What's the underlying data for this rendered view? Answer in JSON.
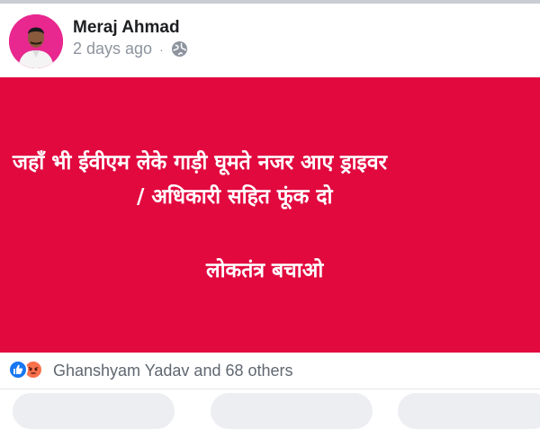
{
  "post": {
    "author": "Meraj Ahmad",
    "time": "2 days ago",
    "separator": "·",
    "privacy_icon": "globe-icon",
    "body_color": "#e2093f",
    "body_lines": [
      "जहाँ भी ईवीएम लेके गाड़ी घूमते नजर आए ड्राइवर",
      "/ अधिकारी सहित फूंक दो",
      "लोकतंत्र बचाओ"
    ]
  },
  "reactions": {
    "icons": [
      "like-icon",
      "angry-icon"
    ],
    "summary": "Ghanshyam Yadav and 68 others"
  },
  "colors": {
    "accent": "#1877f2",
    "angry": "#f7714c",
    "avatar_bg": "#e8278f"
  }
}
